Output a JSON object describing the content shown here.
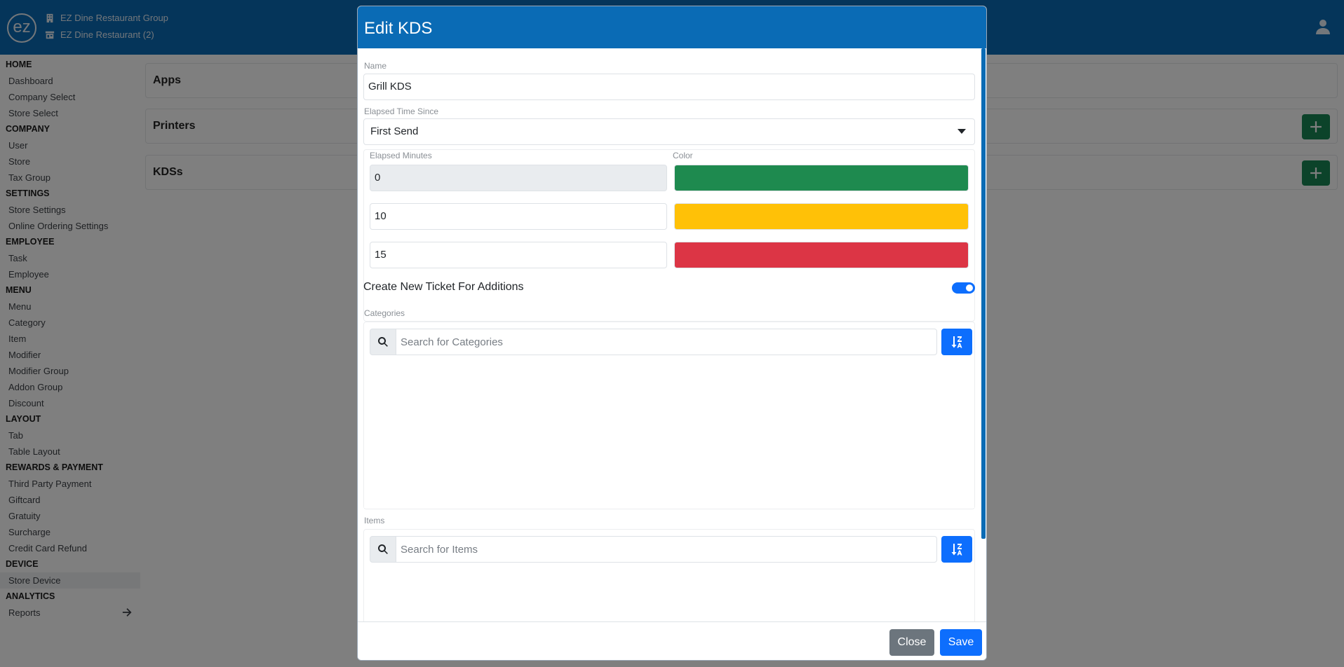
{
  "header": {
    "logo_text": "ez",
    "company_group": "EZ Dine Restaurant Group",
    "restaurant": "EZ Dine Restaurant (2)",
    "icons": [
      "building-icon",
      "store-icon",
      "user-icon"
    ]
  },
  "sidebar": {
    "sections": [
      {
        "title": "HOME",
        "items": [
          "Dashboard",
          "Company Select",
          "Store Select"
        ]
      },
      {
        "title": "COMPANY",
        "items": [
          "User",
          "Store",
          "Tax Group"
        ]
      },
      {
        "title": "SETTINGS",
        "items": [
          "Store Settings",
          "Online Ordering Settings"
        ]
      },
      {
        "title": "EMPLOYEE",
        "items": [
          "Task",
          "Employee"
        ]
      },
      {
        "title": "MENU",
        "items": [
          "Menu",
          "Category",
          "Item",
          "Modifier",
          "Modifier Group",
          "Addon Group",
          "Discount"
        ]
      },
      {
        "title": "LAYOUT",
        "items": [
          "Tab",
          "Table Layout"
        ]
      },
      {
        "title": "REWARDS & PAYMENT",
        "items": [
          "Third Party Payment",
          "Giftcard",
          "Gratuity",
          "Surcharge",
          "Credit Card Refund"
        ]
      },
      {
        "title": "DEVICE",
        "items": [
          "Store Device"
        ]
      },
      {
        "title": "ANALYTICS",
        "items": [
          "Reports"
        ]
      }
    ],
    "active_item": "Store Device"
  },
  "main": {
    "panels": [
      {
        "title": "Apps",
        "has_add": false
      },
      {
        "title": "Printers",
        "has_add": true
      },
      {
        "title": "KDSs",
        "has_add": true
      }
    ]
  },
  "modal": {
    "title": "Edit KDS",
    "name_label": "Name",
    "name_value": "Grill KDS",
    "elapsed_since_label": "Elapsed Time Since",
    "elapsed_since_value": "First Send",
    "elapsed_minutes_label": "Elapsed Minutes",
    "color_label": "Color",
    "thresholds": [
      {
        "minutes": "0",
        "color": "#1e8a4f"
      },
      {
        "minutes": "10",
        "color": "#ffc107"
      },
      {
        "minutes": "15",
        "color": "#dc3545"
      }
    ],
    "toggle_label": "Create New Ticket For Additions",
    "toggle_on": true,
    "categories_label": "Categories",
    "categories_placeholder": "Search for Categories",
    "items_label": "Items",
    "items_placeholder": "Search for Items",
    "close_label": "Close",
    "save_label": "Save"
  },
  "colors": {
    "brand": "#0a6bb5",
    "primary": "#0d6efd",
    "success": "#198754",
    "secondary": "#6c757d"
  }
}
